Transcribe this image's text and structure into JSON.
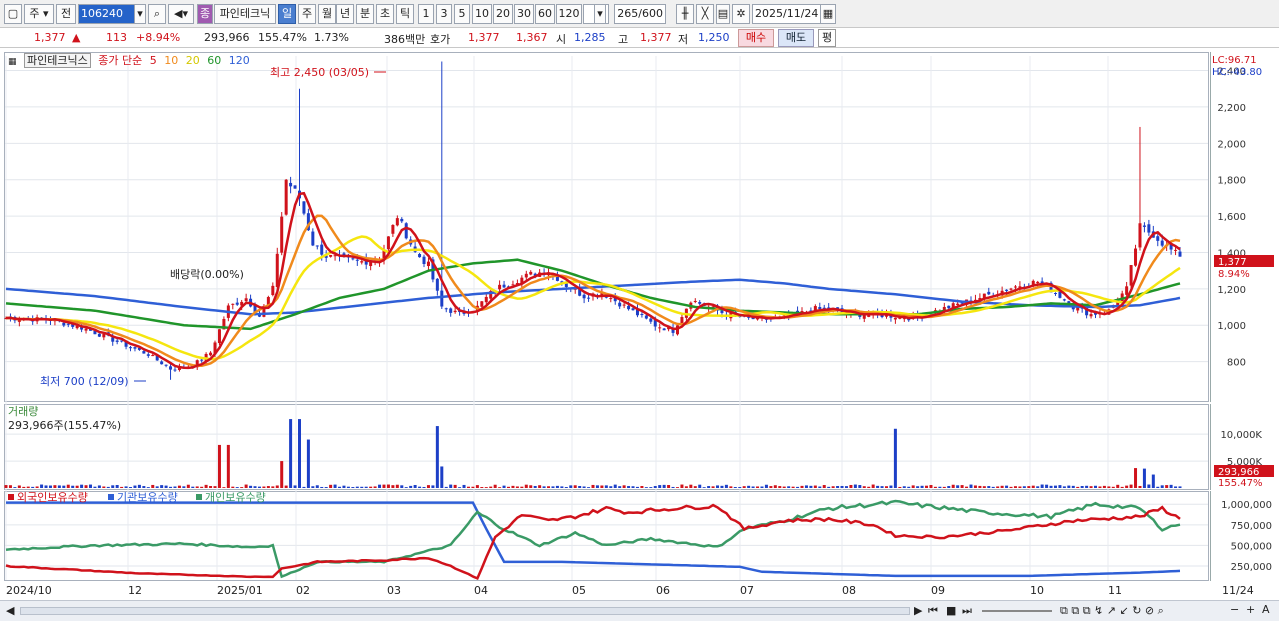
{
  "toolbar": {
    "market_label": "주",
    "prev_label": "전",
    "code_value": "106240",
    "badge_label": "종",
    "stock_name": "파인테크닉",
    "period_day": "일",
    "period_week": "주",
    "period_month": "월",
    "period_year": "년",
    "period_minute": "분",
    "period_second": "초",
    "period_tick": "틱",
    "intervals": [
      "1",
      "3",
      "5",
      "10",
      "20",
      "30",
      "60",
      "120"
    ],
    "count_value": "265",
    "count_total": "/600",
    "date_value": "2025/11/24"
  },
  "quote": {
    "price": "1,377",
    "change": "113",
    "change_pct": "+8.94%",
    "volume": "293,966",
    "volume_ratio": "155.47%",
    "turnover_pct": "1.73%",
    "amount": "386백만",
    "bid_label": "호가",
    "ask_price": "1,377",
    "bid_price": "1,367",
    "open_label": "시",
    "open_price": "1,285",
    "high_label": "고",
    "high_price": "1,377",
    "low_label": "저",
    "low_price": "1,250",
    "buy_label": "매수",
    "sell_label": "매도",
    "avg_label": "평"
  },
  "colors": {
    "up": "#d0121b",
    "down": "#1c3fc7",
    "ma5": "#d0121b",
    "ma10": "#f08a1c",
    "ma20": "#f5e60f",
    "ma60": "#20952a",
    "ma120": "#2f5fd6",
    "foreign": "#d0121b",
    "institution": "#2f5fd6",
    "individual": "#3a9a66"
  },
  "legend": {
    "name": "파인테크닉스",
    "series_title": "종가 단순",
    "ma5": "5",
    "ma10": "10",
    "ma20": "20",
    "ma60": "60",
    "ma120": "120"
  },
  "chart_data": [
    {
      "type": "candlestick",
      "title": "파인테크닉스",
      "ylim": [
        600,
        2480
      ],
      "yticks": [
        "800",
        "1,000",
        "1,200",
        "1,400",
        "1,600",
        "1,800",
        "2,000",
        "2,200",
        "2,400"
      ],
      "lc_label": "LC:96.71",
      "hc_label": "HC:-43.80",
      "last_price_label": "1,377",
      "last_change_label": "8.94%",
      "annotations": {
        "high": "최고 2,450 (03/05)",
        "low": "최저 700 (12/09)",
        "dividend": "배당락(0.00%)"
      },
      "x_labels": [
        "2024/10",
        "12",
        "2025/01",
        "02",
        "03",
        "04",
        "05",
        "06",
        "07",
        "08",
        "09",
        "10",
        "11",
        "11/24"
      ],
      "close_anchors": [
        [
          0,
          1040
        ],
        [
          10,
          1030
        ],
        [
          18,
          980
        ],
        [
          26,
          900
        ],
        [
          32,
          840
        ],
        [
          37,
          760
        ],
        [
          42,
          780
        ],
        [
          46,
          850
        ],
        [
          50,
          1100
        ],
        [
          54,
          1150
        ],
        [
          57,
          1050
        ],
        [
          60,
          1200
        ],
        [
          63,
          1800
        ],
        [
          66,
          1700
        ],
        [
          69,
          1450
        ],
        [
          72,
          1380
        ],
        [
          76,
          1360
        ],
        [
          80,
          1350
        ],
        [
          84,
          1360
        ],
        [
          88,
          1600
        ],
        [
          92,
          1400
        ],
        [
          95,
          1330
        ],
        [
          98,
          1100
        ],
        [
          102,
          1060
        ],
        [
          106,
          1100
        ],
        [
          110,
          1200
        ],
        [
          114,
          1240
        ],
        [
          118,
          1280
        ],
        [
          122,
          1300
        ],
        [
          126,
          1220
        ],
        [
          130,
          1160
        ],
        [
          134,
          1180
        ],
        [
          138,
          1120
        ],
        [
          142,
          1060
        ],
        [
          146,
          1000
        ],
        [
          150,
          970
        ],
        [
          154,
          1140
        ],
        [
          158,
          1100
        ],
        [
          162,
          1060
        ],
        [
          166,
          1040
        ],
        [
          170,
          1030
        ],
        [
          174,
          1040
        ],
        [
          178,
          1060
        ],
        [
          182,
          1090
        ],
        [
          186,
          1080
        ],
        [
          190,
          1060
        ],
        [
          195,
          1060
        ],
        [
          200,
          1050
        ],
        [
          204,
          1040
        ],
        [
          208,
          1070
        ],
        [
          212,
          1100
        ],
        [
          216,
          1130
        ],
        [
          220,
          1160
        ],
        [
          224,
          1190
        ],
        [
          228,
          1220
        ],
        [
          232,
          1240
        ],
        [
          236,
          1180
        ],
        [
          240,
          1100
        ],
        [
          244,
          1060
        ],
        [
          248,
          1080
        ],
        [
          252,
          1200
        ],
        [
          255,
          1540
        ],
        [
          258,
          1500
        ],
        [
          261,
          1430
        ],
        [
          264,
          1377
        ]
      ],
      "ma60_anchors": [
        [
          0,
          1120
        ],
        [
          20,
          1080
        ],
        [
          40,
          1000
        ],
        [
          55,
          980
        ],
        [
          65,
          1060
        ],
        [
          75,
          1150
        ],
        [
          85,
          1200
        ],
        [
          95,
          1300
        ],
        [
          105,
          1340
        ],
        [
          115,
          1360
        ],
        [
          125,
          1300
        ],
        [
          135,
          1220
        ],
        [
          145,
          1150
        ],
        [
          155,
          1100
        ],
        [
          165,
          1080
        ],
        [
          175,
          1070
        ],
        [
          185,
          1060
        ],
        [
          195,
          1060
        ],
        [
          205,
          1060
        ],
        [
          215,
          1090
        ],
        [
          225,
          1100
        ],
        [
          235,
          1120
        ],
        [
          245,
          1110
        ],
        [
          255,
          1170
        ],
        [
          264,
          1230
        ]
      ],
      "ma120_anchors": [
        [
          0,
          1200
        ],
        [
          20,
          1160
        ],
        [
          40,
          1100
        ],
        [
          55,
          1060
        ],
        [
          65,
          1070
        ],
        [
          80,
          1110
        ],
        [
          95,
          1150
        ],
        [
          110,
          1180
        ],
        [
          125,
          1200
        ],
        [
          140,
          1220
        ],
        [
          155,
          1240
        ],
        [
          165,
          1250
        ],
        [
          175,
          1230
        ],
        [
          185,
          1200
        ],
        [
          200,
          1170
        ],
        [
          215,
          1130
        ],
        [
          230,
          1110
        ],
        [
          245,
          1100
        ],
        [
          255,
          1110
        ],
        [
          264,
          1150
        ]
      ]
    },
    {
      "type": "bar",
      "title": "거래량",
      "subtitle": "293,966주(155.47%)",
      "ylim": [
        0,
        13000
      ],
      "yticks": [
        "5,000K",
        "10,000K"
      ],
      "last_volume_label": "293,966",
      "last_volume_pct": "155.47%",
      "spikes": [
        [
          48,
          8000
        ],
        [
          50,
          8000
        ],
        [
          62,
          5000
        ],
        [
          64,
          12800
        ],
        [
          66,
          12800
        ],
        [
          68,
          9000
        ],
        [
          97,
          11500
        ],
        [
          98,
          4000
        ],
        [
          200,
          11000
        ],
        [
          254,
          3700
        ],
        [
          256,
          3600
        ],
        [
          258,
          2500
        ],
        [
          264,
          294
        ]
      ]
    },
    {
      "type": "line",
      "title": "외국인보유수량",
      "series": [
        {
          "name": "외국인보유수량"
        },
        {
          "name": "기관보유수량"
        },
        {
          "name": "개인보유수량"
        }
      ],
      "ylim": [
        80000,
        1100000
      ],
      "yticks": [
        "250,000",
        "500,000",
        "750,000",
        "1,000,000"
      ],
      "foreign_anchors": [
        [
          0,
          250000
        ],
        [
          30,
          160000
        ],
        [
          55,
          120000
        ],
        [
          60,
          120000
        ],
        [
          62,
          220000
        ],
        [
          70,
          300000
        ],
        [
          85,
          320000
        ],
        [
          95,
          350000
        ],
        [
          100,
          250000
        ],
        [
          106,
          100000
        ],
        [
          110,
          600000
        ],
        [
          116,
          870000
        ],
        [
          122,
          800000
        ],
        [
          128,
          850000
        ],
        [
          135,
          950000
        ],
        [
          140,
          900000
        ],
        [
          150,
          950000
        ],
        [
          160,
          980000
        ],
        [
          166,
          700000
        ],
        [
          175,
          800000
        ],
        [
          185,
          820000
        ],
        [
          195,
          750000
        ],
        [
          200,
          620000
        ],
        [
          210,
          600000
        ],
        [
          225,
          680000
        ],
        [
          240,
          800000
        ],
        [
          255,
          850000
        ],
        [
          260,
          950000
        ],
        [
          264,
          820000
        ]
      ],
      "institution_anchors": [
        [
          0,
          1020000
        ],
        [
          60,
          1020000
        ],
        [
          100,
          1020000
        ],
        [
          105,
          1020000
        ],
        [
          108,
          700000
        ],
        [
          112,
          300000
        ],
        [
          125,
          300000
        ],
        [
          165,
          240000
        ],
        [
          170,
          180000
        ],
        [
          200,
          130000
        ],
        [
          230,
          130000
        ],
        [
          255,
          170000
        ],
        [
          264,
          190000
        ]
      ],
      "individual_anchors": [
        [
          0,
          450000
        ],
        [
          20,
          500000
        ],
        [
          40,
          520000
        ],
        [
          55,
          480000
        ],
        [
          60,
          500000
        ],
        [
          62,
          120000
        ],
        [
          70,
          300000
        ],
        [
          85,
          300000
        ],
        [
          100,
          500000
        ],
        [
          106,
          900000
        ],
        [
          112,
          700000
        ],
        [
          120,
          500000
        ],
        [
          128,
          650000
        ],
        [
          135,
          500000
        ],
        [
          145,
          580000
        ],
        [
          160,
          480000
        ],
        [
          166,
          700000
        ],
        [
          175,
          800000
        ],
        [
          185,
          950000
        ],
        [
          200,
          1020000
        ],
        [
          220,
          900000
        ],
        [
          235,
          850000
        ],
        [
          245,
          1000000
        ],
        [
          255,
          950000
        ],
        [
          260,
          700000
        ],
        [
          264,
          760000
        ]
      ]
    }
  ]
}
